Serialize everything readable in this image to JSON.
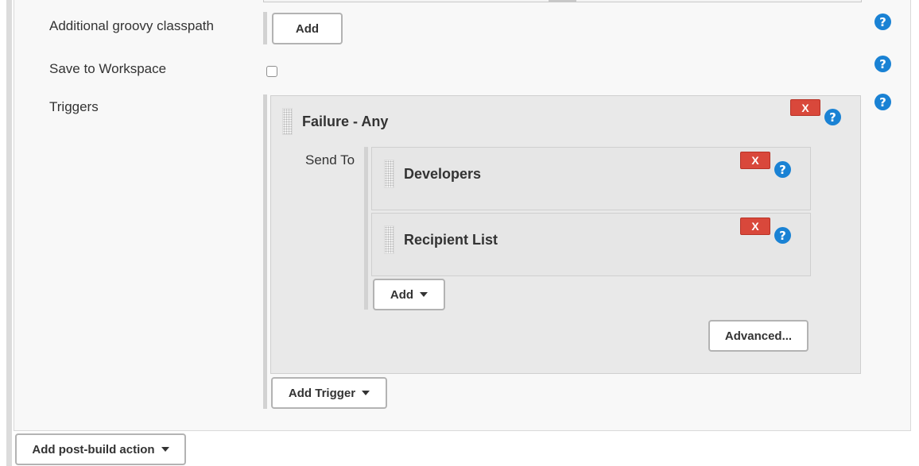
{
  "fields": {
    "groovy_classpath_label": "Additional groovy classpath",
    "save_workspace_label": "Save to Workspace",
    "triggers_label": "Triggers"
  },
  "buttons": {
    "classpath_add": "Add",
    "recipients_add": "Add",
    "advanced": "Advanced...",
    "add_trigger": "Add Trigger",
    "add_post_build_action": "Add post-build action"
  },
  "trigger": {
    "title": "Failure - Any",
    "send_to_label": "Send To",
    "recipients": [
      {
        "title": "Developers"
      },
      {
        "title": "Recipient List"
      }
    ]
  },
  "glyphs": {
    "help": "?",
    "delete": "X"
  },
  "save_to_workspace_checked": false,
  "icons": [
    "help-icon",
    "delete-icon",
    "drag-handle-icon",
    "caret-down-icon"
  ],
  "colors": {
    "help_blue": "#1a82d4",
    "delete_red": "#d9483b",
    "panel_gray": "#e9e9e9"
  }
}
